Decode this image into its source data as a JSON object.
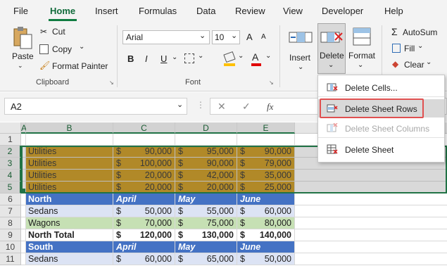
{
  "menu_tabs": [
    {
      "label": "File"
    },
    {
      "label": "Home"
    },
    {
      "label": "Insert"
    },
    {
      "label": "Formulas"
    },
    {
      "label": "Data"
    },
    {
      "label": "Review"
    },
    {
      "label": "View"
    },
    {
      "label": "Developer"
    },
    {
      "label": "Help"
    }
  ],
  "active_tab": "Home",
  "clipboard": {
    "paste": "Paste",
    "cut": "Cut",
    "copy": "Copy",
    "format_painter": "Format Painter",
    "group": "Clipboard"
  },
  "font": {
    "name": "Arial",
    "size": "10",
    "bold": "B",
    "italic": "I",
    "underline": "U",
    "font_color_glyph": "A",
    "group": "Font",
    "grow": "A",
    "shrink": "A"
  },
  "cells_group": {
    "insert": "Insert",
    "delete": "Delete",
    "format": "Format"
  },
  "editing": {
    "autosum": "AutoSum",
    "fill": "Fill",
    "clear": "Clear"
  },
  "formula_bar": {
    "name_box": "A2",
    "fx": "fx",
    "value": ""
  },
  "columns": [
    "A",
    "B",
    "C",
    "D",
    "E"
  ],
  "rows": [
    {
      "n": "1",
      "cells": [
        "",
        "",
        "",
        "",
        ""
      ]
    },
    {
      "n": "2",
      "cells": [
        "Utilities",
        "$",
        "90,000",
        "$",
        "95,000",
        "$",
        "90,000"
      ]
    },
    {
      "n": "3",
      "cells": [
        "Utilities",
        "$",
        "100,000",
        "$",
        "90,000",
        "$",
        "79,000"
      ]
    },
    {
      "n": "4",
      "cells": [
        "Utilities",
        "$",
        "20,000",
        "$",
        "42,000",
        "$",
        "35,000"
      ]
    },
    {
      "n": "5",
      "cells": [
        "Utilities",
        "$",
        "20,000",
        "$",
        "20,000",
        "$",
        "25,000"
      ]
    },
    {
      "n": "6",
      "cells": [
        "North",
        "April",
        "May",
        "June"
      ]
    },
    {
      "n": "7",
      "cells": [
        "Sedans",
        "$",
        "50,000",
        "$",
        "55,000",
        "$",
        "60,000"
      ]
    },
    {
      "n": "8",
      "cells": [
        "Wagons",
        "$",
        "70,000",
        "$",
        "75,000",
        "$",
        "80,000"
      ]
    },
    {
      "n": "9",
      "cells": [
        "North Total",
        "$",
        "120,000",
        "$",
        "130,000",
        "$",
        "140,000"
      ]
    },
    {
      "n": "10",
      "cells": [
        "South",
        "April",
        "May",
        "June"
      ]
    },
    {
      "n": "11",
      "cells": [
        "Sedans",
        "$",
        "60,000",
        "$",
        "65,000",
        "$",
        "50,000"
      ]
    }
  ],
  "delete_menu": {
    "items": [
      {
        "label": "Delete Cells...",
        "enabled": true
      },
      {
        "label": "Delete Sheet Rows",
        "enabled": true,
        "highlighted": true
      },
      {
        "label": "Delete Sheet Columns",
        "enabled": false
      },
      {
        "label": "Delete Sheet",
        "enabled": true
      }
    ]
  },
  "colors": {
    "accent": "#217346",
    "utilities_fill": "#c8900a",
    "header_fill": "#4472c4",
    "sedans_fill": "#dce3f4",
    "wagons_fill": "#c6e0b4",
    "highlight_border": "#e05050"
  }
}
